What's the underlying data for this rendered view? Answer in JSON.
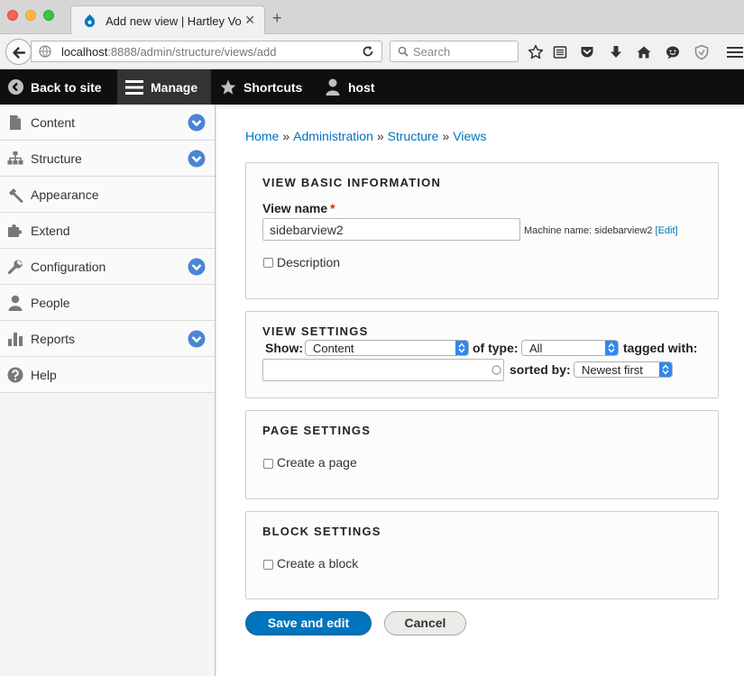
{
  "browser": {
    "tab_title": "Add new view | Hartley Voi…",
    "url_host": "localhost",
    "url_rest": ":8888/admin/structure/views/add",
    "search_placeholder": "Search",
    "icons": [
      "bookmark-star-icon",
      "reading-list-icon",
      "pocket-icon",
      "download-icon",
      "home-icon",
      "chat-icon",
      "shield-icon",
      "menu-icon"
    ]
  },
  "toolbar": {
    "back": "Back to site",
    "manage": "Manage",
    "shortcuts": "Shortcuts",
    "user": "host"
  },
  "sidebar": {
    "items": [
      {
        "label": "Content",
        "icon": "file-icon",
        "expandable": true
      },
      {
        "label": "Structure",
        "icon": "sitemap-icon",
        "expandable": true
      },
      {
        "label": "Appearance",
        "icon": "paintbrush-icon",
        "expandable": false
      },
      {
        "label": "Extend",
        "icon": "puzzle-icon",
        "expandable": false
      },
      {
        "label": "Configuration",
        "icon": "wrench-icon",
        "expandable": true
      },
      {
        "label": "People",
        "icon": "person-icon",
        "expandable": false
      },
      {
        "label": "Reports",
        "icon": "bar-chart-icon",
        "expandable": true
      },
      {
        "label": "Help",
        "icon": "question-icon",
        "expandable": false
      }
    ]
  },
  "breadcrumb": [
    "Home",
    "Administration",
    "Structure",
    "Views"
  ],
  "breadcrumb_sep": "»",
  "basic_info": {
    "legend": "VIEW BASIC INFORMATION",
    "name_label": "View name",
    "required_mark": "*",
    "name_value": "sidebarview2",
    "machine_name_prefix": "Machine name: sidebarview2",
    "machine_edit": "[Edit]",
    "description_label": "Description"
  },
  "view_settings": {
    "legend": "VIEW SETTINGS",
    "show_label": "Show:",
    "show_value": "Content",
    "type_label": "of type:",
    "type_value": "All",
    "tagged_label": "tagged with:",
    "tagged_value": "",
    "sorted_label": "sorted by:",
    "sorted_value": "Newest first"
  },
  "page_settings": {
    "legend": "PAGE SETTINGS",
    "create_label": "Create a page"
  },
  "block_settings": {
    "legend": "BLOCK SETTINGS",
    "create_label": "Create a block"
  },
  "actions": {
    "save": "Save and edit",
    "cancel": "Cancel"
  },
  "colors": {
    "link": "#0074bd",
    "primary_button": "#0074bd",
    "toolbar_bg": "#0f0f0f",
    "expand_icon": "#4a86d4",
    "required": "#e62600"
  }
}
